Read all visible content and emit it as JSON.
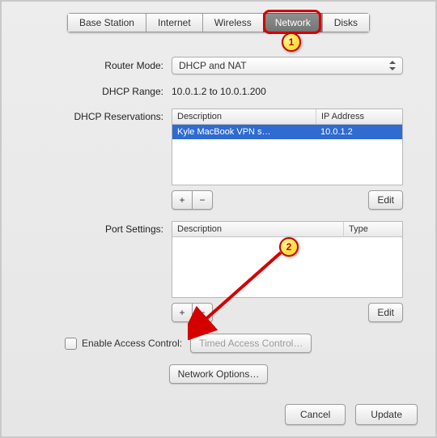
{
  "tabs": {
    "base": "Base Station",
    "internet": "Internet",
    "wireless": "Wireless",
    "network": "Network",
    "disks": "Disks"
  },
  "labels": {
    "router_mode": "Router Mode:",
    "dhcp_range": "DHCP Range:",
    "dhcp_res": "DHCP Reservations:",
    "port": "Port Settings:",
    "access": "Enable Access Control:"
  },
  "router_mode_value": "DHCP and NAT",
  "dhcp_range_value": "10.0.1.2 to 10.0.1.200",
  "dhcp_table": {
    "col_desc": "Description",
    "col_ip": "IP Address",
    "row_desc": "Kyle MacBook VPN s…",
    "row_ip": "10.0.1.2"
  },
  "port_table": {
    "col_desc": "Description",
    "col_type": "Type"
  },
  "buttons": {
    "add": "+",
    "remove": "−",
    "edit": "Edit",
    "timed": "Timed Access Control…",
    "netopt": "Network Options…",
    "cancel": "Cancel",
    "update": "Update"
  },
  "callouts": {
    "one": "1",
    "two": "2"
  }
}
